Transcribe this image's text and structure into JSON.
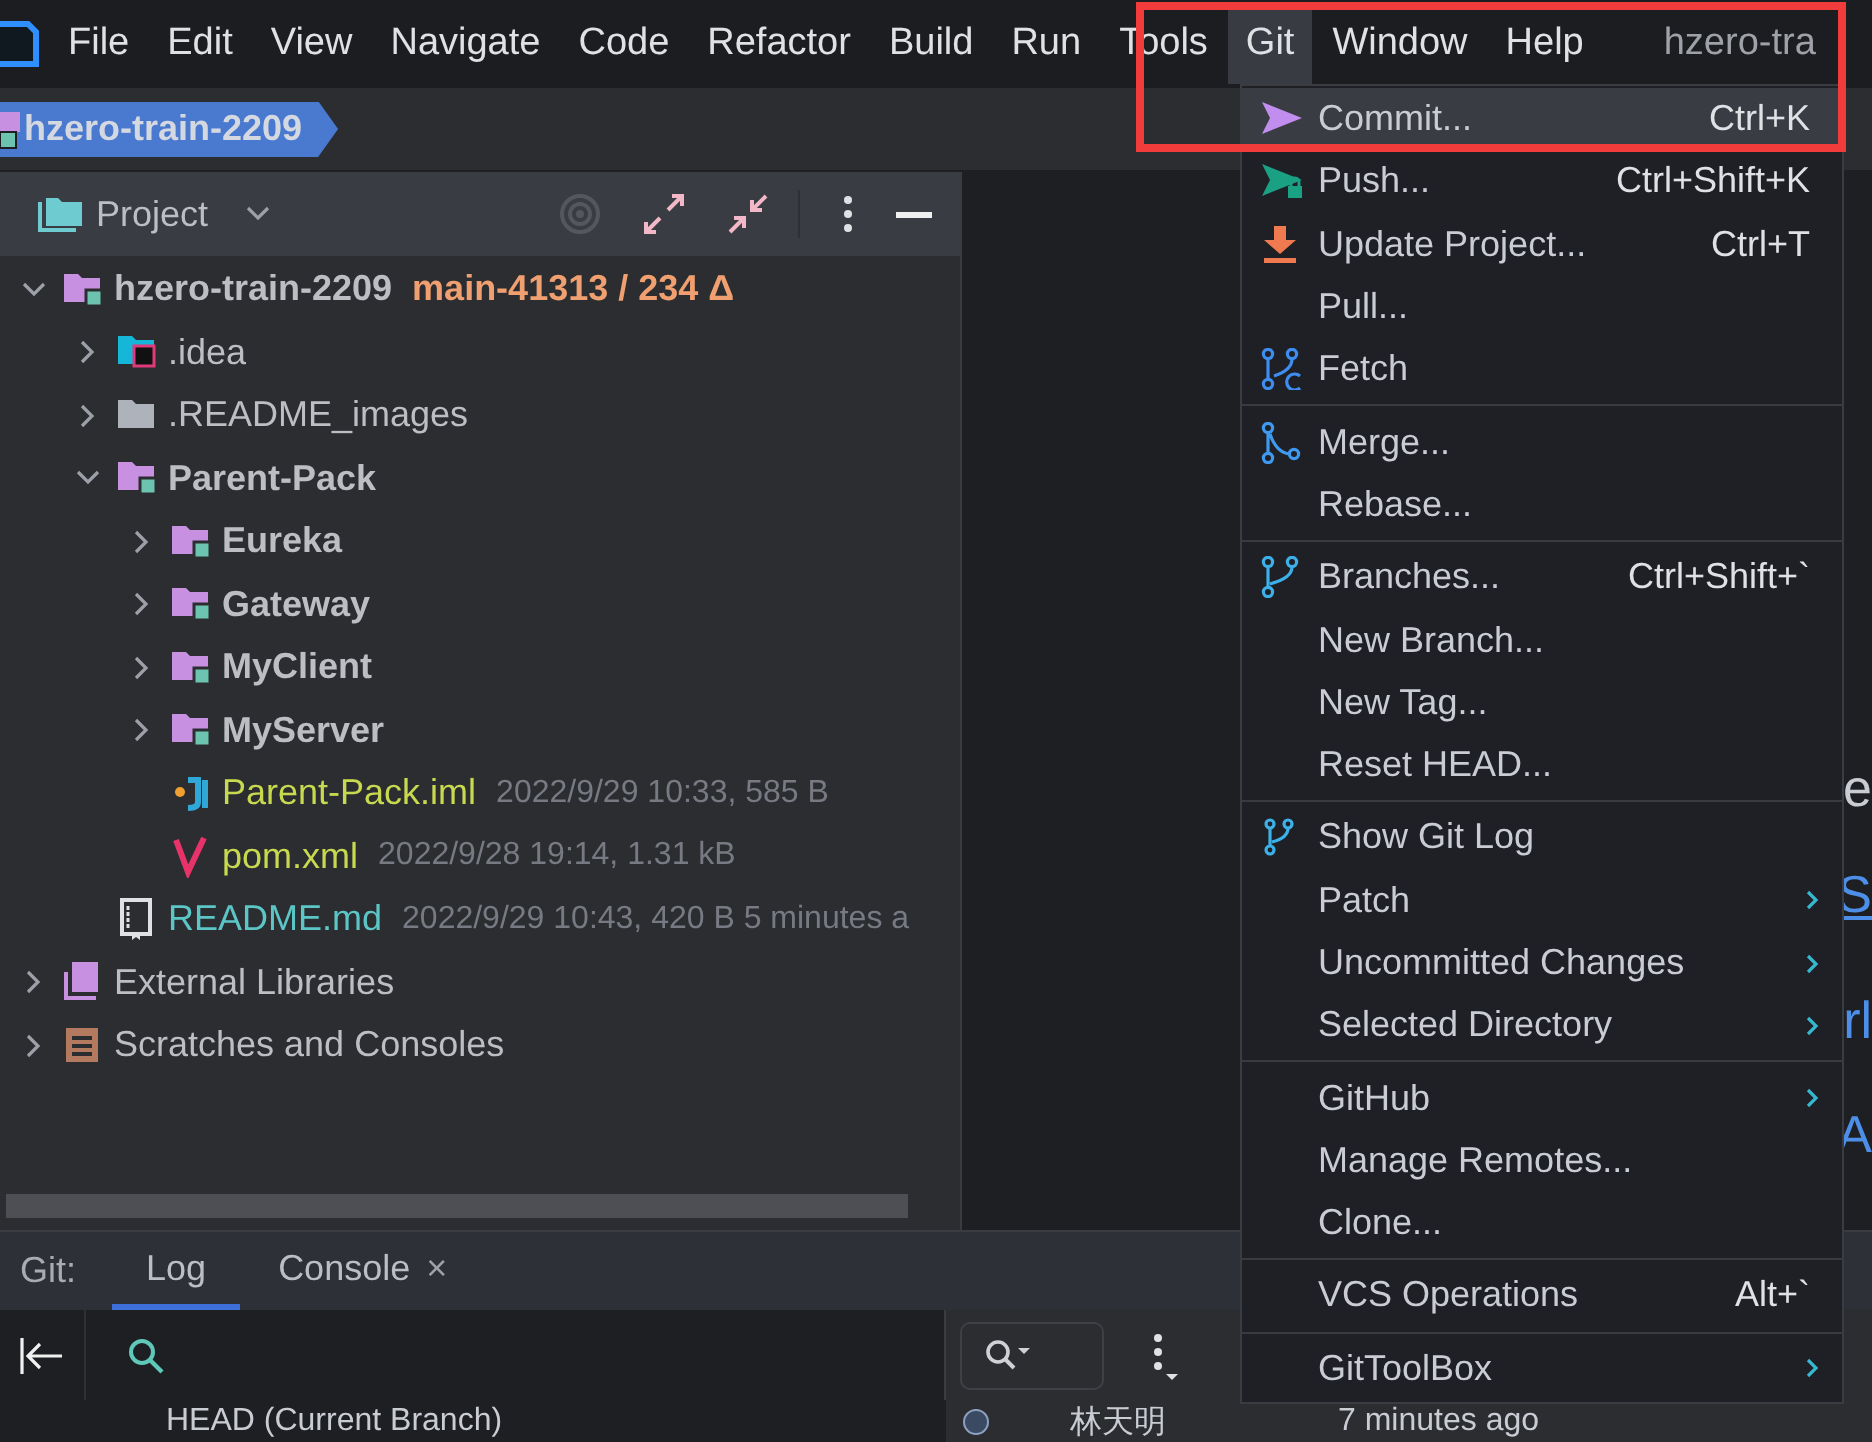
{
  "menu_bar": {
    "items": [
      {
        "label": "File",
        "selected": false
      },
      {
        "label": "Edit",
        "selected": false
      },
      {
        "label": "View",
        "selected": false
      },
      {
        "label": "Navigate",
        "selected": false
      },
      {
        "label": "Code",
        "selected": false
      },
      {
        "label": "Refactor",
        "selected": false
      },
      {
        "label": "Build",
        "selected": false
      },
      {
        "label": "Run",
        "selected": false
      },
      {
        "label": "Tools",
        "selected": false
      },
      {
        "label": "Git",
        "selected": true
      },
      {
        "label": "Window",
        "selected": false
      },
      {
        "label": "Help",
        "selected": false
      }
    ],
    "title": "hzero-tra"
  },
  "breadcrumb": {
    "label": "hzero-train-2209"
  },
  "project_panel": {
    "title": "Project",
    "tree": [
      {
        "label": "hzero-train-2209",
        "kind": "module",
        "expanded": true,
        "color": "#bcbec4",
        "branch": "main-41313 / 234 Δ",
        "children": [
          {
            "label": ".idea",
            "kind": "idea",
            "expanded": false,
            "color": "#bcbec4"
          },
          {
            "label": ".README_images",
            "kind": "folder",
            "expanded": false,
            "color": "#bcbec4"
          },
          {
            "label": "Parent-Pack",
            "kind": "module",
            "expanded": true,
            "color": "#bcbec4",
            "children": [
              {
                "label": "Eureka",
                "kind": "module",
                "expanded": false,
                "color": "#bcbec4"
              },
              {
                "label": "Gateway",
                "kind": "module",
                "expanded": false,
                "color": "#bcbec4"
              },
              {
                "label": "MyClient",
                "kind": "module",
                "expanded": false,
                "color": "#bcbec4"
              },
              {
                "label": "MyServer",
                "kind": "module",
                "expanded": false,
                "color": "#bcbec4"
              },
              {
                "label": "Parent-Pack.iml",
                "kind": "iml",
                "color": "#c8d94f",
                "details": "2022/9/29 10:33, 585 B"
              },
              {
                "label": "pom.xml",
                "kind": "maven",
                "color": "#c8d94f",
                "details": "2022/9/28 19:14, 1.31 kB"
              }
            ]
          },
          {
            "label": "README.md",
            "kind": "markdown",
            "color": "#5cc6c6",
            "details": "2022/9/29 10:43, 420 B 5 minutes a"
          }
        ]
      },
      {
        "label": "External Libraries",
        "kind": "libraries",
        "expanded": false,
        "color": "#bcbec4"
      },
      {
        "label": "Scratches and Consoles",
        "kind": "scratches",
        "expanded": false,
        "color": "#bcbec4"
      }
    ]
  },
  "editor": {
    "fragments": [
      {
        "text": "e",
        "color": "#c9ccd3"
      },
      {
        "text": "S",
        "color": "#4d8fe8"
      },
      {
        "text": "rl",
        "color": "#4d8fe8"
      },
      {
        "text": "A",
        "color": "#4d8fe8"
      }
    ]
  },
  "git_menu": {
    "groups": [
      {
        "items": [
          {
            "label": "Commit...",
            "shortcut": "Ctrl+K",
            "kind": "commit",
            "submenu": false,
            "selected": true
          },
          {
            "label": "Push...",
            "shortcut": "Ctrl+Shift+K",
            "kind": "push",
            "submenu": false,
            "selected": false
          },
          {
            "label": "Update Project...",
            "shortcut": "Ctrl+T",
            "kind": "update",
            "submenu": false,
            "selected": false
          },
          {
            "label": "Pull...",
            "kind": "plain",
            "submenu": false,
            "selected": false
          },
          {
            "label": "Fetch",
            "kind": "fetch",
            "submenu": false,
            "selected": false
          }
        ]
      },
      {
        "items": [
          {
            "label": "Merge...",
            "kind": "merge",
            "submenu": false,
            "selected": false
          },
          {
            "label": "Rebase...",
            "kind": "plain",
            "submenu": false,
            "selected": false
          }
        ]
      },
      {
        "items": [
          {
            "label": "Branches...",
            "shortcut": "Ctrl+Shift+`",
            "kind": "branches",
            "submenu": false,
            "selected": false
          },
          {
            "label": "New Branch...",
            "kind": "plain",
            "submenu": false,
            "selected": false
          },
          {
            "label": "New Tag...",
            "kind": "plain",
            "submenu": false,
            "selected": false
          },
          {
            "label": "Reset HEAD...",
            "kind": "plain",
            "submenu": false,
            "selected": false
          }
        ]
      },
      {
        "items": [
          {
            "label": "Show Git Log",
            "kind": "log",
            "submenu": false,
            "selected": false
          },
          {
            "label": "Patch",
            "kind": "plain",
            "submenu": true,
            "selected": false
          },
          {
            "label": "Uncommitted Changes",
            "kind": "plain",
            "submenu": true,
            "selected": false
          },
          {
            "label": "Selected Directory",
            "kind": "plain",
            "submenu": true,
            "selected": false
          }
        ]
      },
      {
        "items": [
          {
            "label": "GitHub",
            "kind": "plain",
            "submenu": true,
            "selected": false
          },
          {
            "label": "Manage Remotes...",
            "kind": "plain",
            "submenu": false,
            "selected": false
          },
          {
            "label": "Clone...",
            "kind": "plain",
            "submenu": false,
            "selected": false
          }
        ]
      },
      {
        "items": [
          {
            "label": "VCS Operations",
            "shortcut": "Alt+`",
            "kind": "plain",
            "submenu": false,
            "selected": false
          }
        ]
      },
      {
        "items": [
          {
            "label": "GitToolBox",
            "kind": "plain",
            "submenu": true,
            "selected": false
          }
        ]
      }
    ]
  },
  "annotation": {
    "kind": "rectangle"
  },
  "git_tool_window": {
    "label": "Git:",
    "tabs": [
      {
        "label": "Log",
        "selected": true,
        "closable": false
      },
      {
        "label": "Console",
        "selected": false,
        "closable": true,
        "close": "×"
      }
    ],
    "branches": [
      {
        "label": "HEAD (Current Branch)"
      }
    ],
    "commits": [
      {
        "author": "林天明",
        "time": "7 minutes ago"
      }
    ]
  }
}
